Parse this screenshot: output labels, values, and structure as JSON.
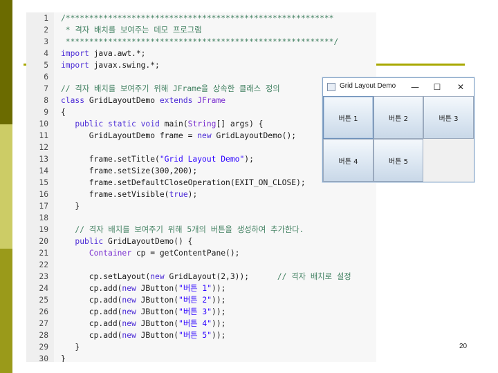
{
  "code": {
    "lines": [
      {
        "n": "1",
        "parts": [
          {
            "t": "/*********************************************************",
            "c": "cm"
          }
        ]
      },
      {
        "n": "2",
        "parts": [
          {
            "t": " * 격자 배치를 보여주는 데모 프로그램",
            "c": "cm"
          }
        ]
      },
      {
        "n": "3",
        "parts": [
          {
            "t": " *********************************************************/",
            "c": "cm"
          }
        ]
      },
      {
        "n": "4",
        "parts": [
          {
            "t": "import",
            "c": "kw"
          },
          {
            "t": " java.awt.*;",
            "c": ""
          }
        ]
      },
      {
        "n": "5",
        "parts": [
          {
            "t": "import",
            "c": "kw"
          },
          {
            "t": " javax.swing.*;",
            "c": ""
          }
        ]
      },
      {
        "n": "6",
        "parts": []
      },
      {
        "n": "7",
        "parts": [
          {
            "t": "// 격자 배치를 보여주기 위해 JFrame을 상속한 클래스 정의",
            "c": "cm"
          }
        ]
      },
      {
        "n": "8",
        "parts": [
          {
            "t": "class",
            "c": "kw"
          },
          {
            "t": " GridLayoutDemo ",
            "c": ""
          },
          {
            "t": "extends",
            "c": "kw"
          },
          {
            "t": " ",
            "c": ""
          },
          {
            "t": "JFrame",
            "c": "ty"
          }
        ]
      },
      {
        "n": "9",
        "parts": [
          {
            "t": "{",
            "c": ""
          }
        ]
      },
      {
        "n": "10",
        "parts": [
          {
            "t": "   ",
            "c": ""
          },
          {
            "t": "public static void",
            "c": "kw"
          },
          {
            "t": " main(",
            "c": ""
          },
          {
            "t": "String",
            "c": "ty"
          },
          {
            "t": "[] args) {",
            "c": ""
          }
        ]
      },
      {
        "n": "11",
        "parts": [
          {
            "t": "      GridLayoutDemo frame = ",
            "c": ""
          },
          {
            "t": "new",
            "c": "kw"
          },
          {
            "t": " GridLayoutDemo();",
            "c": ""
          }
        ]
      },
      {
        "n": "12",
        "parts": []
      },
      {
        "n": "13",
        "parts": [
          {
            "t": "      frame.setTitle(",
            "c": ""
          },
          {
            "t": "\"Grid Layout Demo\"",
            "c": "st"
          },
          {
            "t": ");",
            "c": ""
          }
        ]
      },
      {
        "n": "14",
        "parts": [
          {
            "t": "      frame.setSize(300,200);",
            "c": ""
          }
        ]
      },
      {
        "n": "15",
        "parts": [
          {
            "t": "      frame.setDefaultCloseOperation(EXIT_ON_CLOSE);",
            "c": ""
          }
        ]
      },
      {
        "n": "16",
        "parts": [
          {
            "t": "      frame.setVisible(",
            "c": ""
          },
          {
            "t": "true",
            "c": "kw"
          },
          {
            "t": ");",
            "c": ""
          }
        ]
      },
      {
        "n": "17",
        "parts": [
          {
            "t": "   }",
            "c": ""
          }
        ]
      },
      {
        "n": "18",
        "parts": []
      },
      {
        "n": "19",
        "parts": [
          {
            "t": "   // 격자 배치를 보여주기 위해 5개의 버튼을 생성하여 추가한다.",
            "c": "cm"
          }
        ]
      },
      {
        "n": "20",
        "parts": [
          {
            "t": "   ",
            "c": ""
          },
          {
            "t": "public",
            "c": "kw"
          },
          {
            "t": " GridLayoutDemo() {",
            "c": ""
          }
        ]
      },
      {
        "n": "21",
        "parts": [
          {
            "t": "      ",
            "c": ""
          },
          {
            "t": "Container",
            "c": "ty"
          },
          {
            "t": " cp = getContentPane();",
            "c": ""
          }
        ]
      },
      {
        "n": "22",
        "parts": []
      },
      {
        "n": "23",
        "parts": [
          {
            "t": "      cp.setLayout(",
            "c": ""
          },
          {
            "t": "new",
            "c": "kw"
          },
          {
            "t": " GridLayout(2,3));      ",
            "c": ""
          },
          {
            "t": "// 격자 배치로 설정",
            "c": "cm"
          }
        ]
      },
      {
        "n": "24",
        "parts": [
          {
            "t": "      cp.add(",
            "c": ""
          },
          {
            "t": "new",
            "c": "kw"
          },
          {
            "t": " JButton(",
            "c": ""
          },
          {
            "t": "\"버튼 1\"",
            "c": "st"
          },
          {
            "t": "));",
            "c": ""
          }
        ]
      },
      {
        "n": "25",
        "parts": [
          {
            "t": "      cp.add(",
            "c": ""
          },
          {
            "t": "new",
            "c": "kw"
          },
          {
            "t": " JButton(",
            "c": ""
          },
          {
            "t": "\"버튼 2\"",
            "c": "st"
          },
          {
            "t": "));",
            "c": ""
          }
        ]
      },
      {
        "n": "26",
        "parts": [
          {
            "t": "      cp.add(",
            "c": ""
          },
          {
            "t": "new",
            "c": "kw"
          },
          {
            "t": " JButton(",
            "c": ""
          },
          {
            "t": "\"버튼 3\"",
            "c": "st"
          },
          {
            "t": "));",
            "c": ""
          }
        ]
      },
      {
        "n": "27",
        "parts": [
          {
            "t": "      cp.add(",
            "c": ""
          },
          {
            "t": "new",
            "c": "kw"
          },
          {
            "t": " JButton(",
            "c": ""
          },
          {
            "t": "\"버튼 4\"",
            "c": "st"
          },
          {
            "t": "));",
            "c": ""
          }
        ]
      },
      {
        "n": "28",
        "parts": [
          {
            "t": "      cp.add(",
            "c": ""
          },
          {
            "t": "new",
            "c": "kw"
          },
          {
            "t": " JButton(",
            "c": ""
          },
          {
            "t": "\"버튼 5\"",
            "c": "st"
          },
          {
            "t": "));",
            "c": ""
          }
        ]
      },
      {
        "n": "29",
        "parts": [
          {
            "t": "   }",
            "c": ""
          }
        ]
      },
      {
        "n": "30",
        "parts": [
          {
            "t": "}",
            "c": ""
          }
        ]
      }
    ]
  },
  "window": {
    "title": "Grid Layout Demo",
    "minimize_glyph": "—",
    "maximize_glyph": "☐",
    "close_glyph": "✕",
    "buttons": [
      "버튼 1",
      "버튼 2",
      "버튼 3",
      "버튼 4",
      "버튼 5"
    ]
  },
  "page_number": "20",
  "colors": {
    "comment": "#3f7f5f",
    "keyword": "#4b2bd6",
    "type": "#7a2fd0",
    "string": "#2a00ff",
    "slide_accent": "#a8a800"
  }
}
